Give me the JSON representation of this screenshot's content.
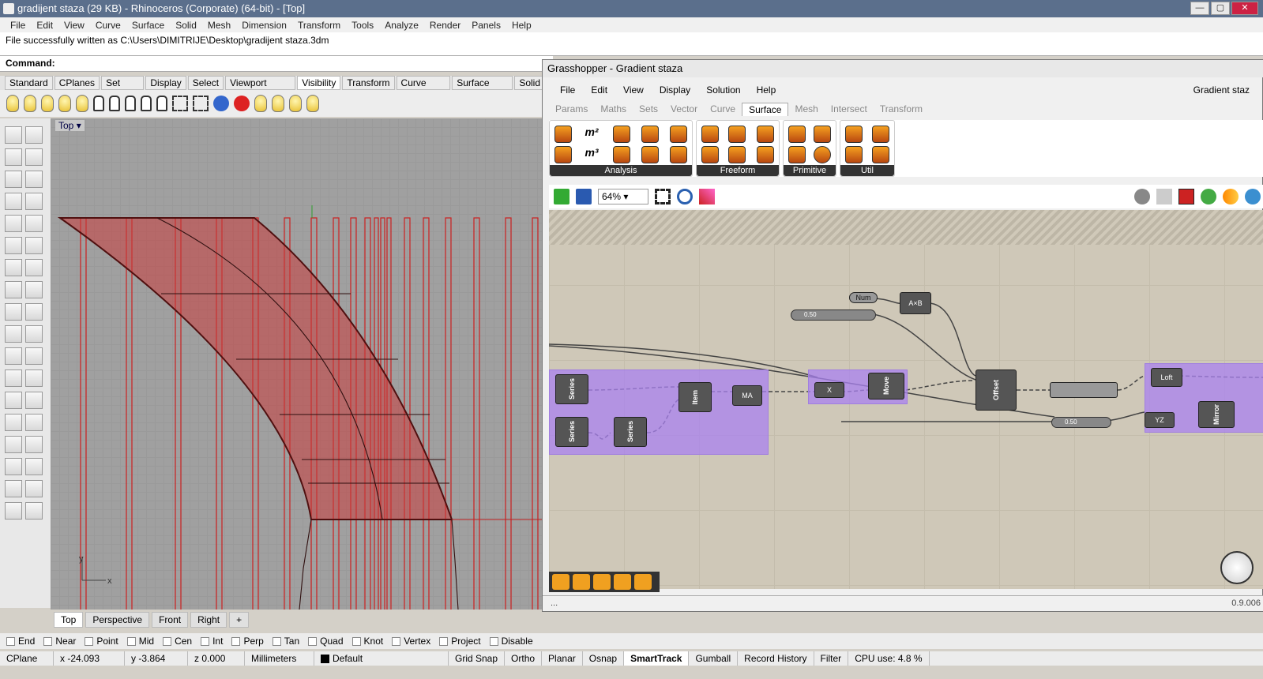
{
  "rhino": {
    "title": "gradijent staza (29 KB) - Rhinoceros (Corporate) (64-bit) - [Top]",
    "window_buttons": [
      "—",
      "▢",
      "✕"
    ],
    "menu": [
      "File",
      "Edit",
      "View",
      "Curve",
      "Surface",
      "Solid",
      "Mesh",
      "Dimension",
      "Transform",
      "Tools",
      "Analyze",
      "Render",
      "Panels",
      "Help"
    ],
    "message": "File successfully written as C:\\Users\\DIMITRIJE\\Desktop\\gradijent staza.3dm",
    "command_label": "Command:",
    "toolbar_tabs": [
      "Standard",
      "CPlanes",
      "Set View",
      "Display",
      "Select",
      "Viewport Layout",
      "Visibility",
      "Transform",
      "Curve Tools",
      "Surface Tools",
      "Solid"
    ],
    "active_toolbar_tab": "Visibility",
    "viewport_label": "Top",
    "viewport_tabs": [
      "Top",
      "Perspective",
      "Front",
      "Right",
      "+"
    ],
    "osnaps": [
      "End",
      "Near",
      "Point",
      "Mid",
      "Cen",
      "Int",
      "Perp",
      "Tan",
      "Quad",
      "Knot",
      "Vertex",
      "Project",
      "Disable"
    ],
    "status": {
      "cplane": "CPlane",
      "x": "x -24.093",
      "y": "y -3.864",
      "z": "z 0.000",
      "units": "Millimeters",
      "layer": "Default",
      "grid_snap": "Grid Snap",
      "ortho": "Ortho",
      "planar": "Planar",
      "osnap": "Osnap",
      "smarttrack": "SmartTrack",
      "gumball": "Gumball",
      "record_history": "Record History",
      "filter": "Filter",
      "cpu": "CPU use: 4.8 %"
    },
    "axis_x": "x",
    "axis_y": "y"
  },
  "gh": {
    "title": "Grasshopper - Gradient staza",
    "doc_name": "Gradient staz",
    "menu": [
      "File",
      "Edit",
      "View",
      "Display",
      "Solution",
      "Help"
    ],
    "tabs": [
      "Params",
      "Maths",
      "Sets",
      "Vector",
      "Curve",
      "Surface",
      "Mesh",
      "Intersect",
      "Transform"
    ],
    "active_tab": "Surface",
    "groups": [
      "Analysis",
      "Freeform",
      "Primitive",
      "Util"
    ],
    "zoom": "64%",
    "components": {
      "num": "Num",
      "axb": "A×B",
      "slider1": "0.50",
      "series1": "Series",
      "series2": "Series",
      "series3": "Series",
      "item": "Item",
      "ma": "MA",
      "x": "X",
      "move": "Move",
      "offset": "Offset",
      "slider2": "0.50",
      "yz": "YZ",
      "loft": "Loft",
      "mirror": "Mirror"
    },
    "status": "...",
    "version": "0.9.006"
  }
}
